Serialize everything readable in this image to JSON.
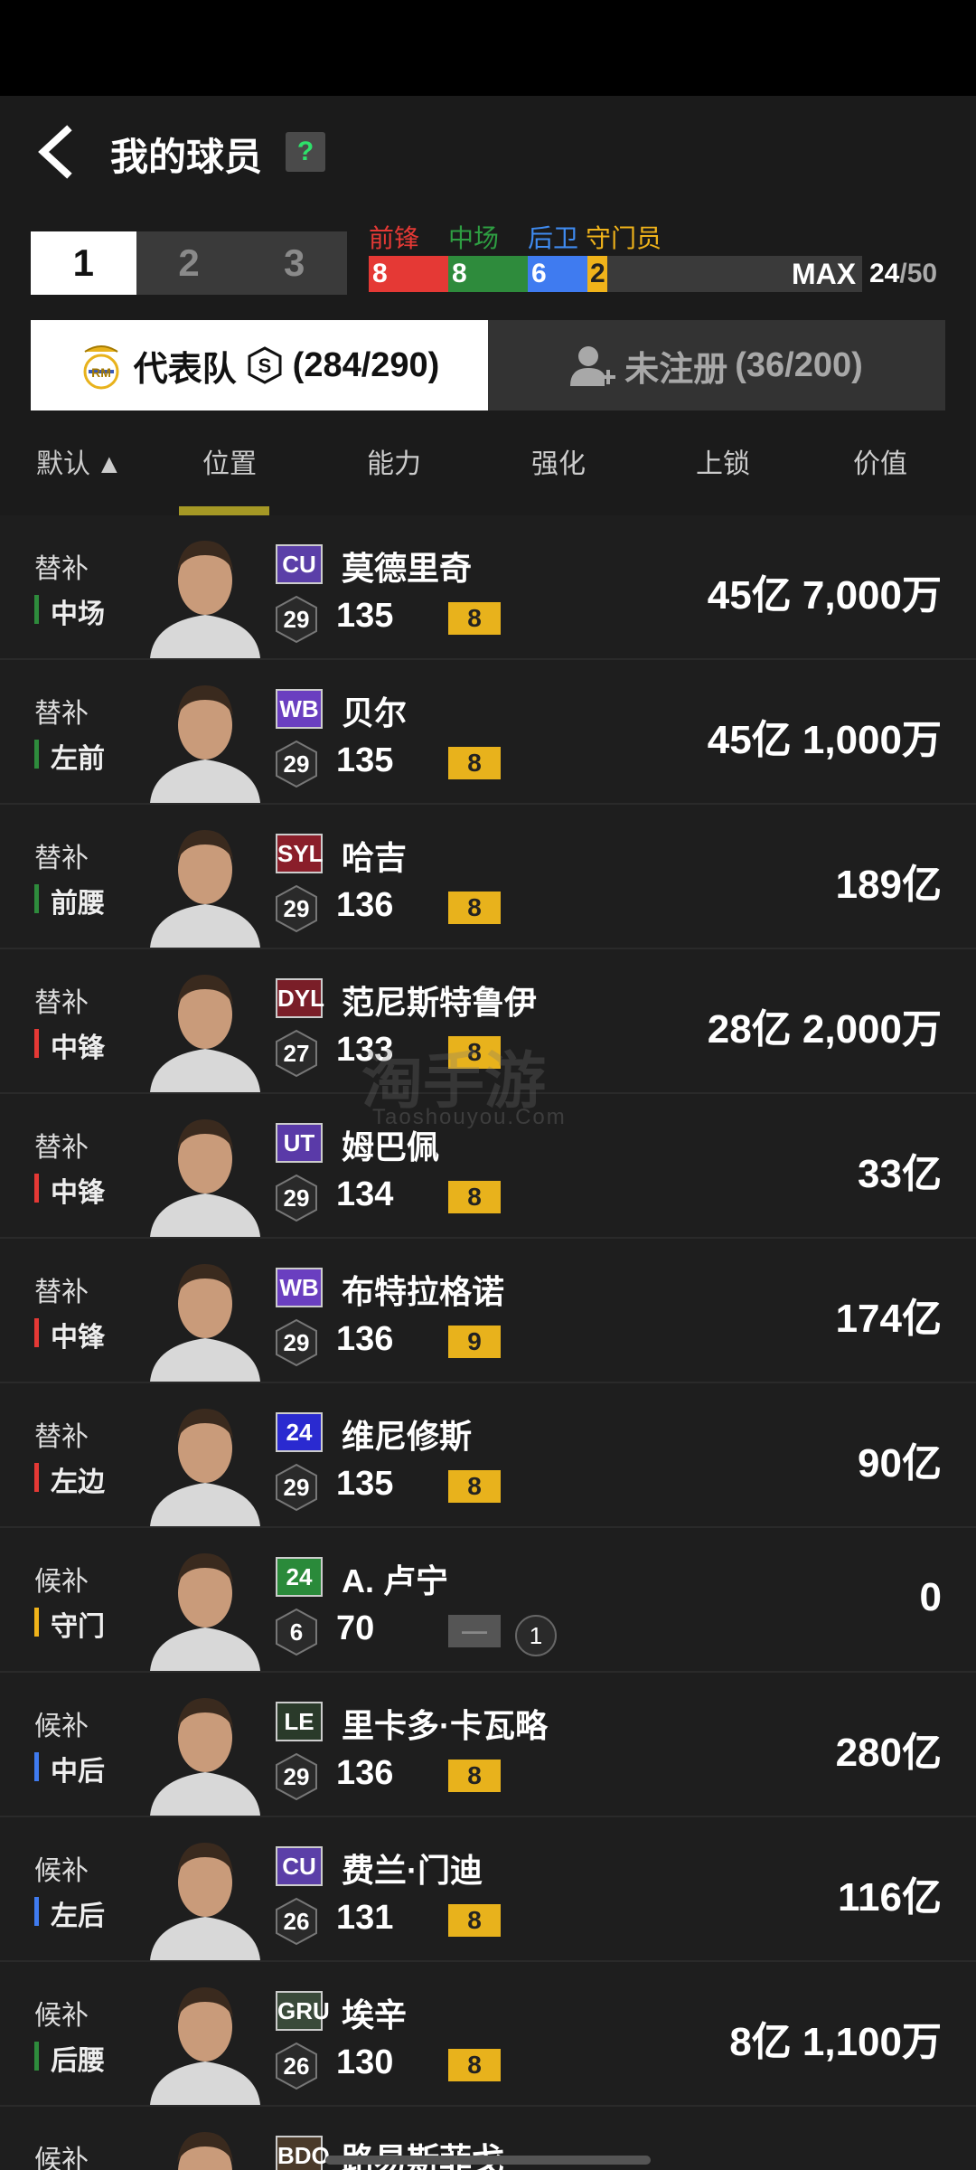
{
  "header": {
    "title": "我的球员",
    "help": "?"
  },
  "page_tabs": [
    "1",
    "2",
    "3"
  ],
  "positions": {
    "labels": [
      {
        "label": "前锋",
        "color": "#e53935"
      },
      {
        "label": "中场",
        "color": "#2e8b3c"
      },
      {
        "label": "后卫",
        "color": "#3f7bf0"
      },
      {
        "label": "守门员",
        "color": "#f0b31a"
      }
    ],
    "counts": [
      "8",
      "8",
      "6",
      "2"
    ],
    "max_label": "MAX",
    "total": "24",
    "limit": "/50"
  },
  "squad_tabs": {
    "registered": "代表队",
    "registered_count": "(284/290)",
    "unregistered": "未注册",
    "unregistered_count": "(36/200)"
  },
  "columns": {
    "default": "默认",
    "position": "位置",
    "ability": "能力",
    "enhance": "强化",
    "lock": "上锁",
    "value": "价值"
  },
  "players": [
    {
      "status": "替补",
      "position": "中场",
      "pos_color": "mid",
      "season": "CU",
      "season_bg": "#5b3fa8",
      "name": "莫德里奇",
      "level": "29",
      "ovr": "135",
      "enh": "8",
      "value": "45亿 7,000万"
    },
    {
      "status": "替补",
      "position": "左前",
      "pos_color": "mid",
      "season": "WB",
      "season_bg": "#6a3fc0",
      "name": "贝尔",
      "level": "29",
      "ovr": "135",
      "enh": "8",
      "value": "45亿 1,000万"
    },
    {
      "status": "替补",
      "position": "前腰",
      "pos_color": "mid",
      "season": "SYL",
      "season_bg": "#8a1e2a",
      "name": "哈吉",
      "level": "29",
      "ovr": "136",
      "enh": "8",
      "value": "189亿"
    },
    {
      "status": "替补",
      "position": "中锋",
      "pos_color": "fwd",
      "season": "DYL",
      "season_bg": "#7a1e28",
      "name": "范尼斯特鲁伊",
      "level": "27",
      "ovr": "133",
      "enh": "8",
      "value": "28亿 2,000万"
    },
    {
      "status": "替补",
      "position": "中锋",
      "pos_color": "fwd",
      "season": "UT",
      "season_bg": "#5a3aa8",
      "name": "姆巴佩",
      "level": "29",
      "ovr": "134",
      "enh": "8",
      "value": "33亿"
    },
    {
      "status": "替补",
      "position": "中锋",
      "pos_color": "fwd",
      "season": "WB",
      "season_bg": "#6a3fc0",
      "name": "布特拉格诺",
      "level": "29",
      "ovr": "136",
      "enh": "9",
      "value": "174亿"
    },
    {
      "status": "替补",
      "position": "左边",
      "pos_color": "fwd",
      "season": "24",
      "season_bg": "#2a2ad0",
      "name": "维尼修斯",
      "level": "29",
      "ovr": "135",
      "enh": "8",
      "value": "90亿"
    },
    {
      "status": "候补",
      "position": "守门",
      "pos_color": "gk",
      "season": "24",
      "season_bg": "#2a8a3a",
      "name": "A. 卢宁",
      "level": "6",
      "ovr": "70",
      "enh": "—",
      "lock": "1",
      "value": "0"
    },
    {
      "status": "候补",
      "position": "中后",
      "pos_color": "def",
      "season": "LE",
      "season_bg": "#2a3a2a",
      "name": "里卡多·卡瓦略",
      "level": "29",
      "ovr": "136",
      "enh": "8",
      "value": "280亿"
    },
    {
      "status": "候补",
      "position": "左后",
      "pos_color": "def",
      "season": "CU",
      "season_bg": "#5b3fa8",
      "name": "费兰·门迪",
      "level": "26",
      "ovr": "131",
      "enh": "8",
      "value": "116亿"
    },
    {
      "status": "候补",
      "position": "后腰",
      "pos_color": "mid",
      "season": "GRU",
      "season_bg": "#3a4a3a",
      "name": "埃辛",
      "level": "26",
      "ovr": "130",
      "enh": "8",
      "value": "8亿 1,100万"
    },
    {
      "status": "候补",
      "position": "",
      "pos_color": "mid",
      "season": "BDO",
      "season_bg": "#4a3a2a",
      "name": "路易斯菲戈",
      "level": "",
      "ovr": "",
      "enh": "",
      "value": ""
    }
  ],
  "watermark": {
    "main": "淘手游",
    "sub": "Taoshouyou.Com"
  }
}
